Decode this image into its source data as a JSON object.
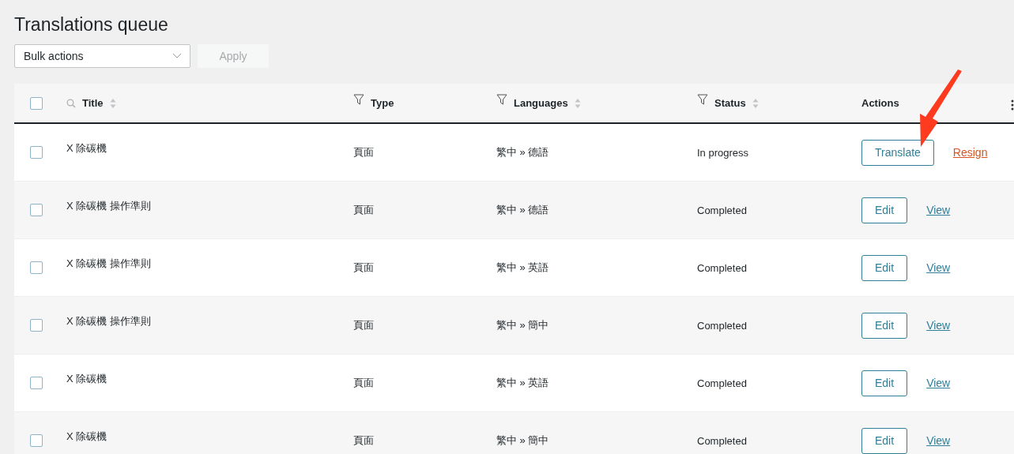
{
  "page_title": "Translations queue",
  "bulk_actions": {
    "value": "Bulk actions",
    "apply": "Apply",
    "apply_disabled": true
  },
  "table": {
    "all_checked": false,
    "columns": [
      {
        "label": "Title",
        "kind": "search",
        "sortable": true
      },
      {
        "label": "Type",
        "kind": "filter",
        "sortable": false
      },
      {
        "label": "Languages",
        "kind": "filter",
        "sortable": true
      },
      {
        "label": "Status",
        "kind": "filter",
        "sortable": true
      },
      {
        "label": "Actions",
        "kind": "plain",
        "sortable": false
      }
    ],
    "rows": [
      {
        "checked": false,
        "title": "X 除碳機",
        "type": "頁面",
        "languages": "繁中 » 德語",
        "status": "In progress",
        "button": "Translate",
        "link": {
          "label": "Resign",
          "kind": "danger"
        }
      },
      {
        "checked": false,
        "title": "X 除碳機 操作準則",
        "type": "頁面",
        "languages": "繁中 » 德語",
        "status": "Completed",
        "button": "Edit",
        "link": {
          "label": "View",
          "kind": "normal"
        }
      },
      {
        "checked": false,
        "title": "X 除碳機 操作準則",
        "type": "頁面",
        "languages": "繁中 » 英語",
        "status": "Completed",
        "button": "Edit",
        "link": {
          "label": "View",
          "kind": "normal"
        }
      },
      {
        "checked": false,
        "title": "X 除碳機 操作準則",
        "type": "頁面",
        "languages": "繁中 » 簡中",
        "status": "Completed",
        "button": "Edit",
        "link": {
          "label": "View",
          "kind": "normal"
        }
      },
      {
        "checked": false,
        "title": "X 除碳機",
        "type": "頁面",
        "languages": "繁中 » 英語",
        "status": "Completed",
        "button": "Edit",
        "link": {
          "label": "View",
          "kind": "normal"
        }
      },
      {
        "checked": false,
        "title": "X 除碳機",
        "type": "頁面",
        "languages": "繁中 » 簡中",
        "status": "Completed",
        "button": "Edit",
        "link": {
          "label": "View",
          "kind": "normal"
        }
      }
    ]
  }
}
